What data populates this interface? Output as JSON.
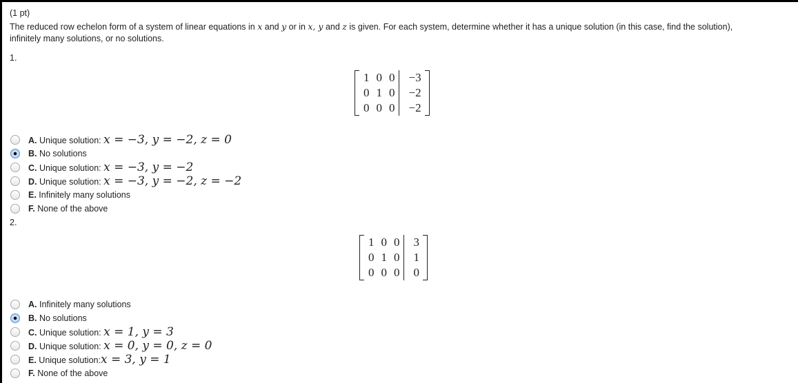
{
  "header": {
    "points": "(1 pt)",
    "instructions_1": "The reduced row echelon form of a system of linear equations in ",
    "var_x": "x",
    "and_1": " and ",
    "var_y": "y",
    "or_in": " or in ",
    "xyz_list": "x, y",
    "and_2": " and ",
    "var_z": "z",
    "instructions_2": " is given. For each system, determine whether it has a unique solution (in this case, find the solution),",
    "instructions_3": "infinitely many solutions, or no solutions."
  },
  "problems": [
    {
      "number": "1.",
      "matrix": [
        [
          "1",
          "0",
          "0",
          "−3"
        ],
        [
          "0",
          "1",
          "0",
          "−2"
        ],
        [
          "0",
          "0",
          "0",
          "−2"
        ]
      ],
      "options": [
        {
          "letter": "A.",
          "text": "Unique solution: ",
          "math": "x = −3, y = −2, z = 0",
          "selected": false
        },
        {
          "letter": "B.",
          "text": "No solutions",
          "math": "",
          "selected": true
        },
        {
          "letter": "C.",
          "text": "Unique solution: ",
          "math": "x = −3, y = −2",
          "selected": false
        },
        {
          "letter": "D.",
          "text": "Unique solution: ",
          "math": "x = −3, y = −2, z = −2",
          "selected": false
        },
        {
          "letter": "E.",
          "text": "Infinitely many solutions",
          "math": "",
          "selected": false
        },
        {
          "letter": "F.",
          "text": "None of the above",
          "math": "",
          "selected": false
        }
      ]
    },
    {
      "number": "2.",
      "matrix": [
        [
          "1",
          "0",
          "0",
          "3"
        ],
        [
          "0",
          "1",
          "0",
          "1"
        ],
        [
          "0",
          "0",
          "0",
          "0"
        ]
      ],
      "options": [
        {
          "letter": "A.",
          "text": "Infinitely many solutions",
          "math": "",
          "selected": false
        },
        {
          "letter": "B.",
          "text": "No solutions",
          "math": "",
          "selected": true
        },
        {
          "letter": "C.",
          "text": "Unique solution: ",
          "math": "x = 1, y = 3",
          "selected": false
        },
        {
          "letter": "D.",
          "text": "Unique solution: ",
          "math": "x = 0, y = 0, z = 0",
          "selected": false
        },
        {
          "letter": "E.",
          "text": "Unique solution:",
          "math": "x = 3, y = 1",
          "selected": false
        },
        {
          "letter": "F.",
          "text": "None of the above",
          "math": "",
          "selected": false
        }
      ]
    }
  ]
}
